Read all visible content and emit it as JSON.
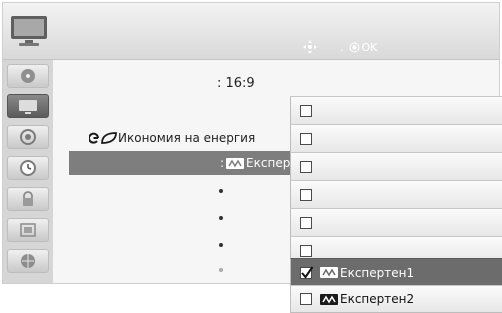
{
  "header": {
    "nav_hint_dot": ".",
    "nav_hint_ok": "OK"
  },
  "sidebar": {
    "items": [
      {
        "icon": "disc-icon",
        "active": false
      },
      {
        "icon": "tv-icon",
        "active": true
      },
      {
        "icon": "speaker-icon",
        "active": false
      },
      {
        "icon": "clock-icon",
        "active": false
      },
      {
        "icon": "lock-icon",
        "active": false
      },
      {
        "icon": "settings-icon",
        "active": false
      },
      {
        "icon": "network-icon",
        "active": false
      }
    ]
  },
  "main": {
    "aspect_value": ": 16:9",
    "energy_label": "Икономия на енергия",
    "highlight_colon": ":",
    "highlight_text": "Експер"
  },
  "dropdown": {
    "options": [
      {
        "label": "",
        "checked": false,
        "logo": false
      },
      {
        "label": "",
        "checked": false,
        "logo": false
      },
      {
        "label": "",
        "checked": false,
        "logo": false
      },
      {
        "label": "",
        "checked": false,
        "logo": false
      },
      {
        "label": "",
        "checked": false,
        "logo": false
      },
      {
        "label": "",
        "checked": false,
        "logo": false
      },
      {
        "label": "Експертен1",
        "checked": true,
        "logo": true
      },
      {
        "label": "Експертен2",
        "checked": false,
        "logo": true
      }
    ]
  },
  "colors": {
    "highlight": "#7e7e7e",
    "selected_row": "#6c6c6c",
    "sidebar": "#d6d6d6",
    "header": "#d9d9d9"
  }
}
